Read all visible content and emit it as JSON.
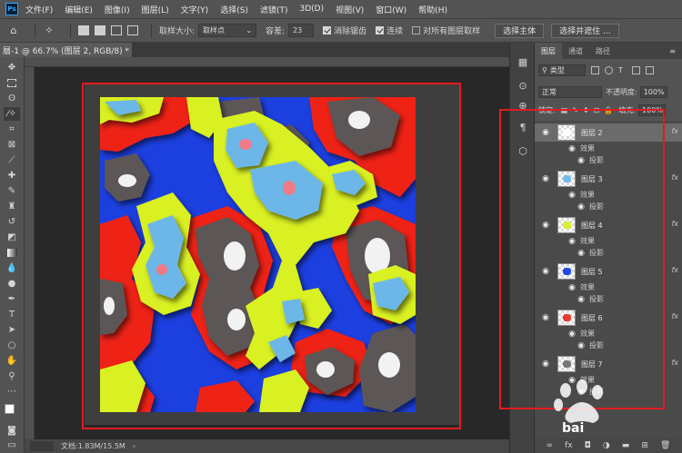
{
  "app": {
    "logo": "Ps"
  },
  "menu": [
    "文件(F)",
    "编辑(E)",
    "图像(I)",
    "图层(L)",
    "文字(Y)",
    "选择(S)",
    "滤镜(T)",
    "3D(D)",
    "视图(V)",
    "窗口(W)",
    "帮助(H)"
  ],
  "options": {
    "sample_size_label": "取样大小:",
    "sample_size_value": "取样点",
    "tolerance_label": "容差:",
    "tolerance_value": "23",
    "antialias_label": "消除锯齿",
    "contiguous_label": "连续",
    "sample_all_label": "对所有图层取样",
    "select_subject": "选择主体",
    "select_mask": "选择并遮住 ..."
  },
  "document": {
    "tab_title": "層-1 @ 66.7% (图层 2, RGB/8) *",
    "status": "文档:1.83M/15.5M"
  },
  "icons": {
    "tools": [
      "move-icon",
      "marquee-icon",
      "lasso-icon",
      "magic-wand-icon",
      "crop-icon",
      "frame-icon",
      "eyedropper-icon",
      "healing-icon",
      "brush-icon",
      "stamp-icon",
      "history-brush-icon",
      "eraser-icon",
      "gradient-icon",
      "blur-icon",
      "dodge-icon",
      "pen-icon",
      "type-icon",
      "path-select-icon",
      "rectangle-icon",
      "hand-icon",
      "zoom-icon",
      "more-icon"
    ],
    "strip": [
      "history-icon",
      "adjust-icon",
      "paths-icon",
      "paragraph-icon",
      "3d-icon"
    ]
  },
  "layers_panel": {
    "tabs": [
      "图层",
      "通道",
      "路径"
    ],
    "filter_label": "类型",
    "blend_mode": "正常",
    "opacity_label": "不透明度:",
    "opacity_value": "100%",
    "lock_label": "锁定:",
    "fill_label": "填充:",
    "fill_value": "100%",
    "effects_label": "效果",
    "shadow_label": "投影",
    "fx_label": "fx",
    "layers": [
      {
        "name": "图层 2",
        "thumb_color": "#ffffff"
      },
      {
        "name": "图层 3",
        "thumb_color": "#74b9ea"
      },
      {
        "name": "图层 4",
        "thumb_color": "#d8ef2a"
      },
      {
        "name": "图层 5",
        "thumb_color": "#2249e0"
      },
      {
        "name": "图层 6",
        "thumb_color": "#e63b2e"
      },
      {
        "name": "图层 7",
        "thumb_color": "#777777"
      }
    ]
  },
  "artwork_colors": {
    "blue": "#1c3fe0",
    "red": "#ef2416",
    "yellow": "#d9f021",
    "light_blue": "#6cb7e8",
    "gray": "#5b5656",
    "white": "#f2f2f2",
    "pink": "#f07a88"
  },
  "highlight_color": "#e21b22",
  "watermark": "bai"
}
